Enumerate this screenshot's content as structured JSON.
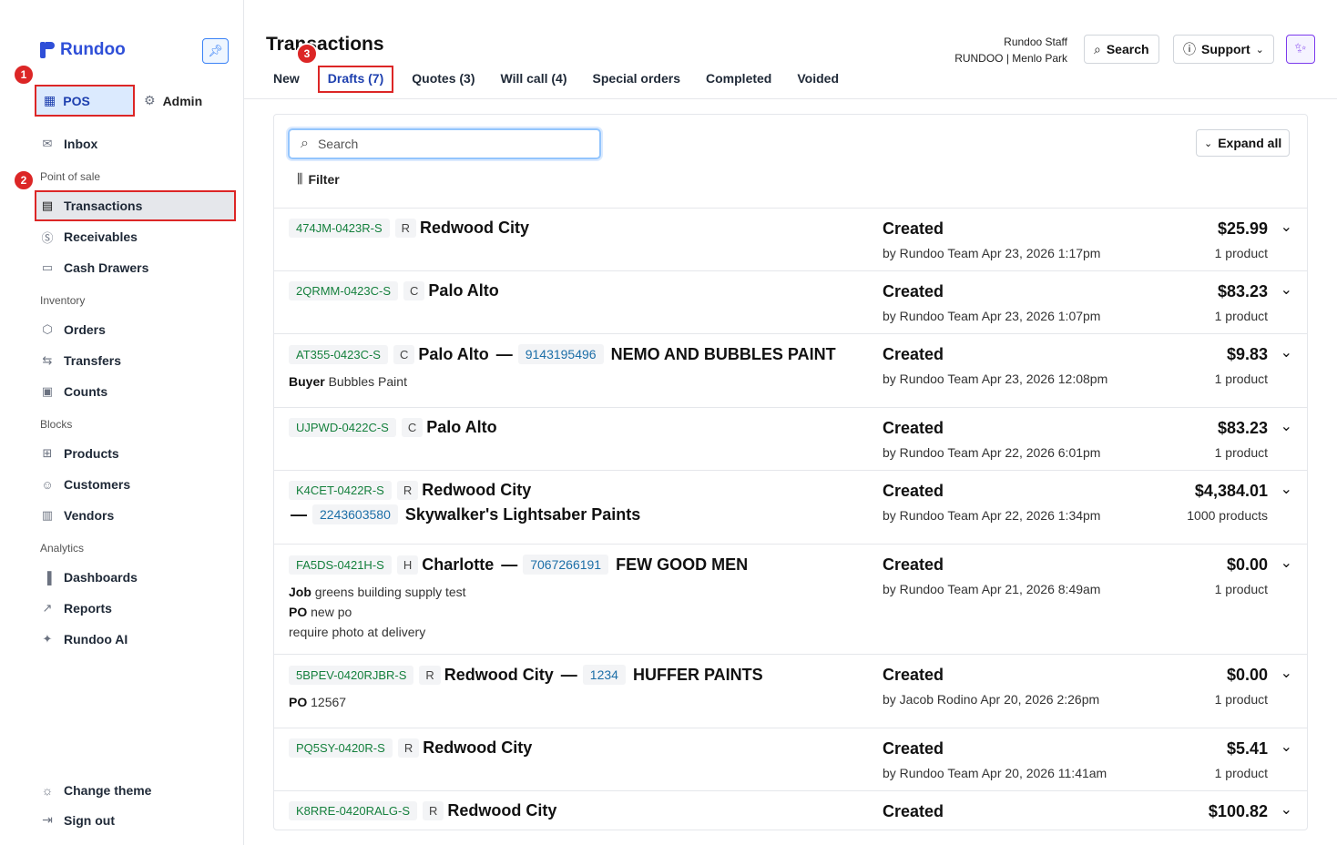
{
  "brand": {
    "name": "Rundoo",
    "color": "#2f4fd8"
  },
  "modes": {
    "pos": "POS",
    "admin": "Admin"
  },
  "nav": {
    "inbox": "Inbox",
    "sections": {
      "pos": "Point of sale",
      "inventory": "Inventory",
      "blocks": "Blocks",
      "analytics": "Analytics"
    },
    "transactions": "Transactions",
    "receivables": "Receivables",
    "cash_drawers": "Cash Drawers",
    "orders": "Orders",
    "transfers": "Transfers",
    "counts": "Counts",
    "products": "Products",
    "customers": "Customers",
    "vendors": "Vendors",
    "dashboards": "Dashboards",
    "reports": "Reports",
    "rundoo_ai": "Rundoo AI",
    "change_theme": "Change theme",
    "sign_out": "Sign out"
  },
  "annotations": [
    "1",
    "2",
    "3"
  ],
  "header": {
    "title": "Transactions",
    "tabs": [
      "New",
      "Drafts (7)",
      "Quotes (3)",
      "Will call (4)",
      "Special orders",
      "Completed",
      "Voided"
    ],
    "staff_name": "Rundoo Staff",
    "staff_store": "RUNDOO | Menlo Park",
    "search_label": "Search",
    "support_label": "Support"
  },
  "toolbar": {
    "search_placeholder": "Search",
    "filter_label": "Filter",
    "expand_label": "Expand all"
  },
  "rows": [
    {
      "id": "474JM-0423R-S",
      "loc_code": "R",
      "location": "Redwood City",
      "phone": "",
      "customer": "",
      "extra": [],
      "status": "Created",
      "by": "by Rundoo Team Apr 23, 2026 1:17pm",
      "amount": "$25.99",
      "count": "1 product"
    },
    {
      "id": "2QRMM-0423C-S",
      "loc_code": "C",
      "location": "Palo Alto",
      "phone": "",
      "customer": "",
      "extra": [],
      "status": "Created",
      "by": "by Rundoo Team Apr 23, 2026 1:07pm",
      "amount": "$83.23",
      "count": "1 product"
    },
    {
      "id": "AT355-0423C-S",
      "loc_code": "C",
      "location": "Palo Alto",
      "phone": "9143195496",
      "customer": "NEMO AND BUBBLES PAINT",
      "extra": [
        {
          "k": "Buyer",
          "v": "Bubbles Paint"
        }
      ],
      "status": "Created",
      "by": "by Rundoo Team Apr 23, 2026 12:08pm",
      "amount": "$9.83",
      "count": "1 product"
    },
    {
      "id": "UJPWD-0422C-S",
      "loc_code": "C",
      "location": "Palo Alto",
      "phone": "",
      "customer": "",
      "extra": [],
      "status": "Created",
      "by": "by Rundoo Team Apr 22, 2026 6:01pm",
      "amount": "$83.23",
      "count": "1 product"
    },
    {
      "id": "K4CET-0422R-S",
      "loc_code": "R",
      "location": "Redwood City",
      "phone": "2243603580",
      "customer": "Skywalker's Lightsaber Paints",
      "extra": [],
      "status": "Created",
      "by": "by Rundoo Team Apr 22, 2026 1:34pm",
      "amount": "$4,384.01",
      "count": "1000 products"
    },
    {
      "id": "FA5DS-0421H-S",
      "loc_code": "H",
      "location": "Charlotte",
      "phone": "7067266191",
      "customer": "FEW GOOD MEN",
      "extra": [
        {
          "k": "Job",
          "v": "greens building supply test"
        },
        {
          "k": "PO",
          "v": "new po"
        },
        {
          "k": "",
          "v": "require photo at delivery"
        }
      ],
      "status": "Created",
      "by": "by Rundoo Team Apr 21, 2026 8:49am",
      "amount": "$0.00",
      "count": "1 product"
    },
    {
      "id": "5BPEV-0420RJBR-S",
      "loc_code": "R",
      "location": "Redwood City",
      "phone": "1234",
      "customer": "HUFFER PAINTS",
      "extra": [
        {
          "k": "PO",
          "v": "12567"
        }
      ],
      "status": "Created",
      "by": "by Jacob Rodino Apr 20, 2026 2:26pm",
      "amount": "$0.00",
      "count": "1 product"
    },
    {
      "id": "PQ5SY-0420R-S",
      "loc_code": "R",
      "location": "Redwood City",
      "phone": "",
      "customer": "",
      "extra": [],
      "status": "Created",
      "by": "by Rundoo Team Apr 20, 2026 11:41am",
      "amount": "$5.41",
      "count": "1 product"
    },
    {
      "id": "K8RRE-0420RALG-S",
      "loc_code": "R",
      "location": "Redwood City",
      "phone": "",
      "customer": "",
      "extra": [],
      "status": "Created",
      "by": "",
      "amount": "$100.82",
      "count": ""
    }
  ]
}
